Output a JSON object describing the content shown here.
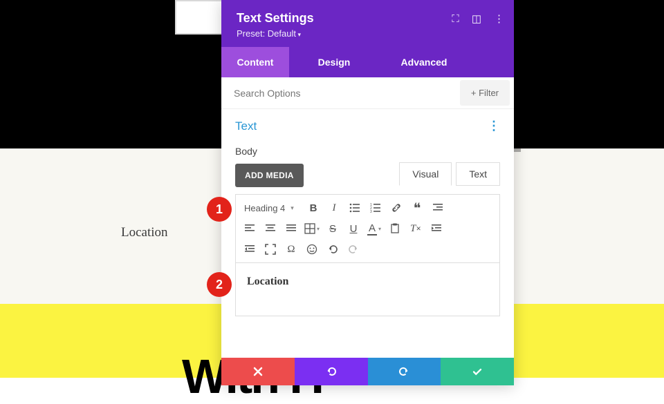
{
  "panel": {
    "title": "Text Settings",
    "preset": "Preset: Default",
    "tabs": [
      "Content",
      "Design",
      "Advanced"
    ],
    "active_tab": 0,
    "search_placeholder": "Search Options",
    "filter_label": "Filter"
  },
  "section": {
    "title": "Text",
    "body_label": "Body",
    "add_media": "ADD MEDIA",
    "editor_tabs": [
      "Visual",
      "Text"
    ],
    "active_editor_tab": 0,
    "format_selector": "Heading 4",
    "content": "Location"
  },
  "background": {
    "label": "Location",
    "bigtext": "    With H"
  },
  "annotations": [
    "1",
    "2"
  ]
}
